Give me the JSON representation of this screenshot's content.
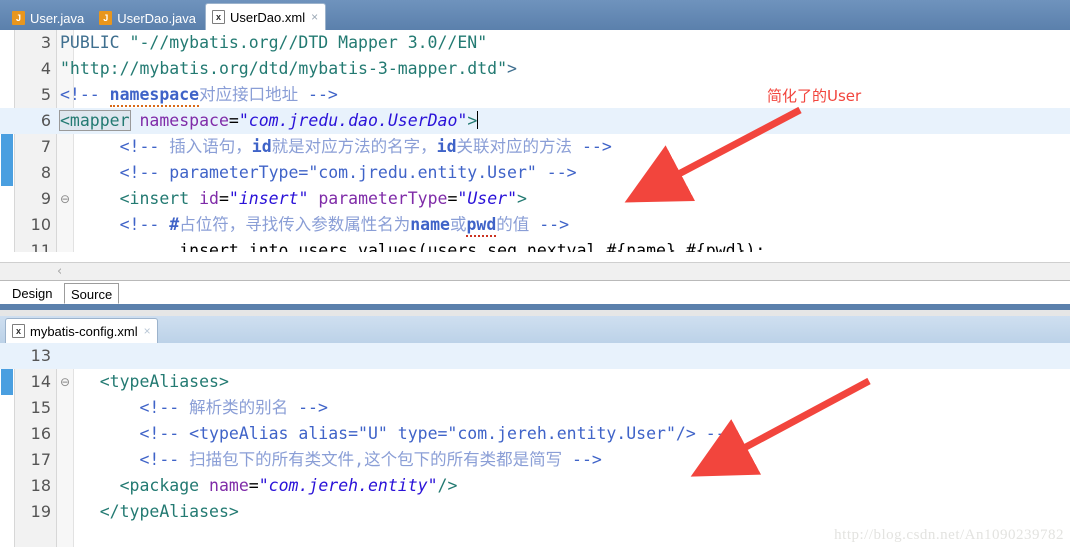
{
  "top_editor": {
    "tabs": [
      {
        "label": "User.java",
        "icon": "java-file-icon",
        "icon_glyph": "J",
        "active": false,
        "closable": false
      },
      {
        "label": "UserDao.java",
        "icon": "java-file-icon",
        "icon_glyph": "J",
        "active": false,
        "closable": false
      },
      {
        "label": "UserDao.xml",
        "icon": "xml-file-icon",
        "icon_glyph": "x",
        "active": true,
        "closable": true,
        "close_glyph": "×"
      }
    ],
    "bottom_tabs": [
      {
        "label": "Design",
        "selected": false
      },
      {
        "label": "Source",
        "selected": true
      }
    ],
    "scroll_left_glyph": "‹",
    "current_line": 6,
    "lines": [
      {
        "num": "3",
        "fold": "",
        "current": false,
        "tokens": [
          {
            "text": "PUBLIC ",
            "cls": "t-dtd"
          },
          {
            "text": "\"-//mybatis.org//DTD Mapper 3.0//EN\"",
            "cls": "t-dtdstr"
          }
        ]
      },
      {
        "num": "4",
        "fold": "",
        "current": false,
        "tokens": [
          {
            "text": "\"http://mybatis.org/dtd/mybatis-3-mapper.dtd\"",
            "cls": "t-dtdstr"
          },
          {
            "text": ">",
            "cls": "t-dtd"
          }
        ]
      },
      {
        "num": "5",
        "fold": "",
        "current": false,
        "tokens": [
          {
            "text": "<!-- ",
            "cls": "t-cmt"
          },
          {
            "text": "namespace",
            "cls": "t-cmt-b",
            "squiggle": "orange"
          },
          {
            "text": "对应接口地址",
            "cls": "t-cmt-cn"
          },
          {
            "text": " -->",
            "cls": "t-cmt"
          }
        ]
      },
      {
        "num": "6",
        "fold": "⊖",
        "current": true,
        "tokens": [
          {
            "text": "<mapper",
            "cls": "t-tag",
            "box": true
          },
          {
            "text": " ",
            "cls": "t-plain"
          },
          {
            "text": "namespace",
            "cls": "t-attr"
          },
          {
            "text": "=",
            "cls": "t-eq"
          },
          {
            "text": "\"com.jredu.dao.UserDao\"",
            "cls": "t-str"
          },
          {
            "text": ">",
            "cls": "t-tag"
          },
          {
            "text": "",
            "cls": "caret"
          }
        ]
      },
      {
        "num": "7",
        "fold": "",
        "current": false,
        "indent": 3,
        "tokens": [
          {
            "text": "<!-- ",
            "cls": "t-cmt"
          },
          {
            "text": "插入语句，",
            "cls": "t-cmt-cn"
          },
          {
            "text": "id",
            "cls": "t-cmt-b"
          },
          {
            "text": "就是对应方法的名字，",
            "cls": "t-cmt-cn"
          },
          {
            "text": "id",
            "cls": "t-cmt-b"
          },
          {
            "text": "关联对应的方法",
            "cls": "t-cmt-cn"
          },
          {
            "text": " -->",
            "cls": "t-cmt"
          }
        ]
      },
      {
        "num": "8",
        "fold": "",
        "current": false,
        "indent": 3,
        "tokens": [
          {
            "text": "<!-- parameterType=\"com.jredu.entity.User\" -->",
            "cls": "t-cmt"
          }
        ]
      },
      {
        "num": "9",
        "fold": "⊖",
        "current": false,
        "indent": 3,
        "tokens": [
          {
            "text": "<insert",
            "cls": "t-tag"
          },
          {
            "text": " ",
            "cls": "t-plain"
          },
          {
            "text": "id",
            "cls": "t-attr"
          },
          {
            "text": "=",
            "cls": "t-eq"
          },
          {
            "text": "\"insert\"",
            "cls": "t-str"
          },
          {
            "text": " ",
            "cls": "t-plain"
          },
          {
            "text": "parameterType",
            "cls": "t-attr"
          },
          {
            "text": "=",
            "cls": "t-eq"
          },
          {
            "text": "\"User\"",
            "cls": "t-str"
          },
          {
            "text": ">",
            "cls": "t-tag"
          }
        ]
      },
      {
        "num": "10",
        "fold": "",
        "current": false,
        "indent": 3,
        "tokens": [
          {
            "text": "<!-- ",
            "cls": "t-cmt"
          },
          {
            "text": "#",
            "cls": "t-cmt-b"
          },
          {
            "text": "占位符，寻找传入参数属性名为",
            "cls": "t-cmt-cn"
          },
          {
            "text": "name",
            "cls": "t-cmt-b"
          },
          {
            "text": "或",
            "cls": "t-cmt-cn"
          },
          {
            "text": "pwd",
            "cls": "t-cmt-b",
            "squiggle": "red"
          },
          {
            "text": "的值",
            "cls": "t-cmt-cn"
          },
          {
            "text": " -->",
            "cls": "t-cmt"
          }
        ]
      },
      {
        "num": "11",
        "fold": "",
        "current": false,
        "indent": 6,
        "clipped": true,
        "tokens": [
          {
            "text": "insert into users values(users_seq.nextval,#{name},#{pwd});",
            "cls": "t-sql"
          }
        ]
      }
    ]
  },
  "bottom_editor": {
    "tabs": [
      {
        "label": "mybatis-config.xml",
        "icon": "xml-file-icon",
        "icon_glyph": "x",
        "active": true,
        "closable": true,
        "close_glyph": "×"
      }
    ],
    "current_line": 13,
    "lines": [
      {
        "num": "13",
        "fold": "",
        "current": true,
        "indent": 0,
        "tokens": []
      },
      {
        "num": "14",
        "fold": "⊖",
        "current": false,
        "indent": 2,
        "tokens": [
          {
            "text": "<typeAliases>",
            "cls": "t-tag"
          }
        ]
      },
      {
        "num": "15",
        "fold": "",
        "current": false,
        "indent": 4,
        "tokens": [
          {
            "text": "<!-- ",
            "cls": "t-cmt"
          },
          {
            "text": "解析类的别名",
            "cls": "t-cmt-cn"
          },
          {
            "text": " -->",
            "cls": "t-cmt"
          }
        ]
      },
      {
        "num": "16",
        "fold": "",
        "current": false,
        "indent": 4,
        "tokens": [
          {
            "text": "<!-- <typeAlias alias=\"U\" type=\"com.jereh.entity.User\"/> -->",
            "cls": "t-cmt"
          }
        ]
      },
      {
        "num": "17",
        "fold": "",
        "current": false,
        "indent": 4,
        "tokens": [
          {
            "text": "<!-- ",
            "cls": "t-cmt"
          },
          {
            "text": "扫描包下的所有类文件,这个包下的所有类都是简写",
            "cls": "t-cmt-cn"
          },
          {
            "text": " -->",
            "cls": "t-cmt"
          }
        ]
      },
      {
        "num": "18",
        "fold": "",
        "current": false,
        "indent": 3,
        "tokens": [
          {
            "text": "<package",
            "cls": "t-tag"
          },
          {
            "text": " ",
            "cls": "t-plain"
          },
          {
            "text": "name",
            "cls": "t-attr"
          },
          {
            "text": "=",
            "cls": "t-eq"
          },
          {
            "text": "\"com.jereh.entity\"",
            "cls": "t-str"
          },
          {
            "text": "/>",
            "cls": "t-tag"
          }
        ]
      },
      {
        "num": "19",
        "fold": "",
        "current": false,
        "indent": 2,
        "tokens": [
          {
            "text": "</typeAliases>",
            "cls": "t-tag"
          }
        ]
      }
    ]
  },
  "annotations": [
    {
      "id": "annot-user-alias",
      "text": "简化了的User",
      "color": "#f2453d"
    }
  ],
  "watermark": {
    "text": "http://blog.csdn.net/An1090239782"
  },
  "colors": {
    "chrome_blue": "#5b80ac",
    "tabbar_blue": "#6f93bd",
    "current_line": "#e8f2fc",
    "annotation_red": "#f2453d",
    "gutter_bg": "#f2f2f2"
  }
}
